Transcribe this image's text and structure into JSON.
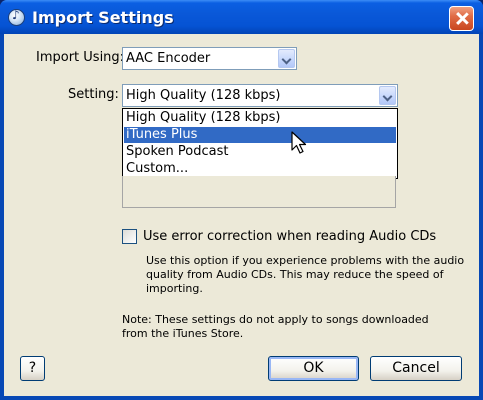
{
  "window": {
    "title": "Import Settings"
  },
  "import_using": {
    "label": "Import Using:",
    "value": "AAC Encoder"
  },
  "setting": {
    "label": "Setting:",
    "value": "High Quality (128 kbps)",
    "options": [
      "High Quality (128 kbps)",
      "iTunes Plus",
      "Spoken Podcast",
      "Custom..."
    ],
    "highlighted_option": "iTunes Plus"
  },
  "error_correction": {
    "label": "Use error correction when reading Audio CDs",
    "checked": false,
    "help_lines": [
      "Use this option if you experience problems with the audio",
      "quality from Audio CDs.  This may reduce the speed of",
      "importing."
    ]
  },
  "note": {
    "lines": [
      "Note: These settings do not apply to songs downloaded",
      "from the iTunes Store."
    ]
  },
  "buttons": {
    "help": "?",
    "ok": "OK",
    "cancel": "Cancel"
  },
  "colors": {
    "title_bar": "#0553d4",
    "dialog_bg": "#ece9d8",
    "selection": "#316ac5",
    "close_button": "#e06b45"
  },
  "icons": {
    "app": "itunes-app-icon",
    "close": "close-icon",
    "dropdown": "chevron-down-icon",
    "cursor": "mouse-pointer-icon"
  }
}
